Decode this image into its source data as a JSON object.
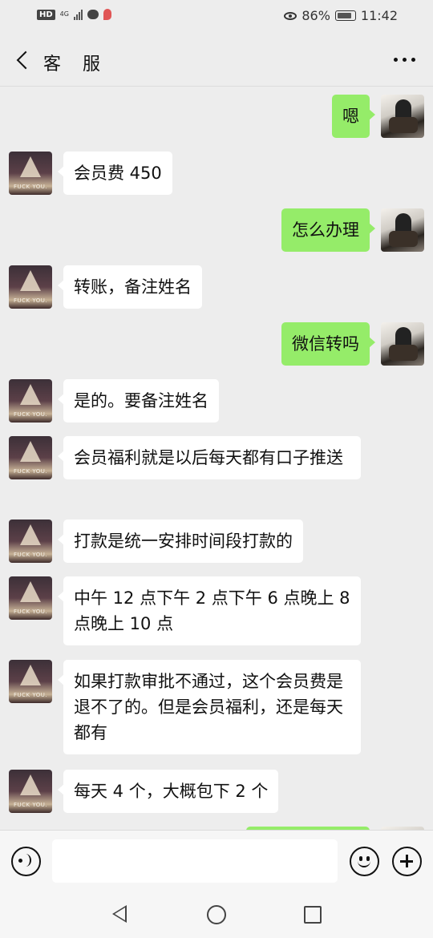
{
  "status_bar": {
    "hd": "HD",
    "network": "4G",
    "battery_percent": "86%",
    "battery_level": 0.86,
    "time": "11:42"
  },
  "header": {
    "title": "客 服"
  },
  "messages": [
    {
      "side": "right",
      "text": "嗯"
    },
    {
      "side": "left",
      "text": "会员费 450"
    },
    {
      "side": "right",
      "text": "怎么办理"
    },
    {
      "side": "left",
      "text": "转账，备注姓名"
    },
    {
      "side": "right",
      "text": "微信转吗"
    },
    {
      "side": "left",
      "text": "是的。要备注姓名"
    },
    {
      "side": "left",
      "text": "会员福利就是以后每天都有口子推送"
    },
    {
      "side": "left",
      "text": "打款是统一安排时间段打款的"
    },
    {
      "side": "left",
      "text": "中午 12 点下午 2 点下午 6 点晚上 8 点晚上 10 点"
    },
    {
      "side": "left",
      "text": "如果打款审批不通过，这个会员费是退不了的。但是会员福利，还是每天都有"
    },
    {
      "side": "left",
      "text": "每天 4 个，大概包下 2 个"
    }
  ],
  "avatar_caption": "FUCK YOU.",
  "input": {
    "placeholder": ""
  },
  "colors": {
    "outgoing_bubble": "#95ec69",
    "incoming_bubble": "#ffffff",
    "background": "#ededed"
  },
  "icons": [
    "back-arrow-icon",
    "more-icon",
    "voice-icon",
    "emoji-icon",
    "plus-icon",
    "nav-back-icon",
    "nav-home-icon",
    "nav-recent-icon"
  ]
}
